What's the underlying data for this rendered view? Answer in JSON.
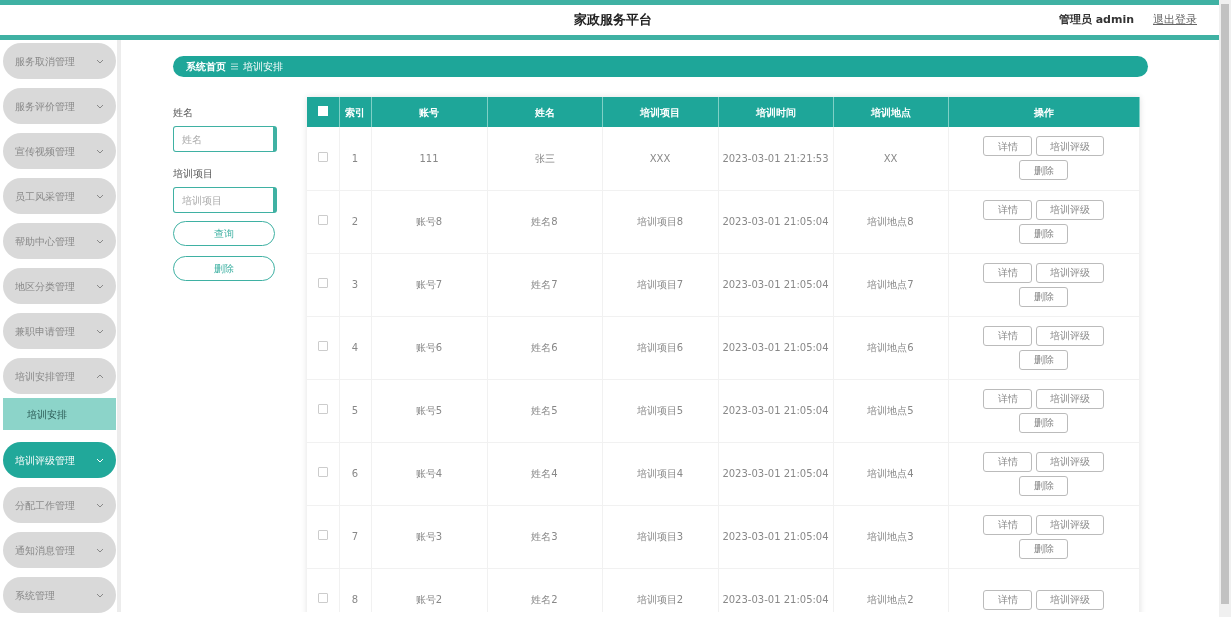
{
  "header": {
    "title": "家政服务平台",
    "user": "管理员 admin",
    "logout": "退出登录"
  },
  "sidebar": {
    "items": [
      {
        "label": "服务取消管理",
        "expanded": false,
        "selected": false
      },
      {
        "label": "服务评价管理",
        "expanded": false,
        "selected": false
      },
      {
        "label": "宣传视频管理",
        "expanded": false,
        "selected": false
      },
      {
        "label": "员工风采管理",
        "expanded": false,
        "selected": false
      },
      {
        "label": "帮助中心管理",
        "expanded": false,
        "selected": false
      },
      {
        "label": "地区分类管理",
        "expanded": false,
        "selected": false
      },
      {
        "label": "兼职申请管理",
        "expanded": false,
        "selected": false
      },
      {
        "label": "培训安排管理",
        "expanded": true,
        "selected": false,
        "children": [
          {
            "label": "培训安排",
            "selected": true
          }
        ]
      },
      {
        "label": "培训评级管理",
        "expanded": false,
        "selected": true
      },
      {
        "label": "分配工作管理",
        "expanded": false,
        "selected": false
      },
      {
        "label": "通知消息管理",
        "expanded": false,
        "selected": false
      },
      {
        "label": "系统管理",
        "expanded": false,
        "selected": false
      }
    ]
  },
  "breadcrumb": [
    "系统首页",
    "培训安排"
  ],
  "search": {
    "fields": [
      {
        "label": "姓名",
        "placeholder": "姓名"
      },
      {
        "label": "培训项目",
        "placeholder": "培训项目"
      }
    ],
    "buttons": [
      "查询",
      "删除"
    ]
  },
  "table": {
    "select_all_checked": false,
    "columns": [
      "索引",
      "账号",
      "姓名",
      "培训项目",
      "培训时间",
      "培训地点",
      "操作"
    ],
    "rows": [
      {
        "checked": false,
        "cells": [
          "1",
          "111",
          "张三",
          "XXX",
          "2023-03-01 21:21:53",
          "XX"
        ],
        "actions": [
          "详情",
          "培训评级",
          "删除"
        ]
      },
      {
        "checked": false,
        "cells": [
          "2",
          "账号8",
          "姓名8",
          "培训项目8",
          "2023-03-01 21:05:04",
          "培训地点8"
        ],
        "actions": [
          "详情",
          "培训评级",
          "删除"
        ]
      },
      {
        "checked": false,
        "cells": [
          "3",
          "账号7",
          "姓名7",
          "培训项目7",
          "2023-03-01 21:05:04",
          "培训地点7"
        ],
        "actions": [
          "详情",
          "培训评级",
          "删除"
        ]
      },
      {
        "checked": false,
        "cells": [
          "4",
          "账号6",
          "姓名6",
          "培训项目6",
          "2023-03-01 21:05:04",
          "培训地点6"
        ],
        "actions": [
          "详情",
          "培训评级",
          "删除"
        ]
      },
      {
        "checked": false,
        "cells": [
          "5",
          "账号5",
          "姓名5",
          "培训项目5",
          "2023-03-01 21:05:04",
          "培训地点5"
        ],
        "actions": [
          "详情",
          "培训评级",
          "删除"
        ]
      },
      {
        "checked": false,
        "cells": [
          "6",
          "账号4",
          "姓名4",
          "培训项目4",
          "2023-03-01 21:05:04",
          "培训地点4"
        ],
        "actions": [
          "详情",
          "培训评级",
          "删除"
        ]
      },
      {
        "checked": false,
        "cells": [
          "7",
          "账号3",
          "姓名3",
          "培训项目3",
          "2023-03-01 21:05:04",
          "培训地点3"
        ],
        "actions": [
          "详情",
          "培训评级",
          "删除"
        ]
      },
      {
        "checked": false,
        "cells": [
          "8",
          "账号2",
          "姓名2",
          "培训项目2",
          "2023-03-01 21:05:04",
          "培训地点2"
        ],
        "actions": [
          "详情",
          "培训评级"
        ]
      }
    ]
  }
}
